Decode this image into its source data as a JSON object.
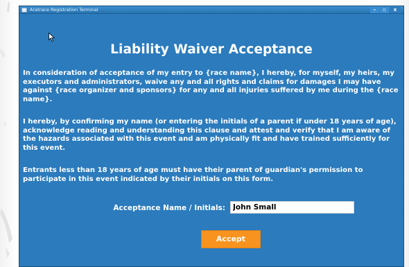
{
  "window": {
    "title": "Aratrace Registration Terminal",
    "controls": {
      "minimize": "–",
      "maximize": "▫",
      "close": "x"
    }
  },
  "heading": "Liability Waiver Acceptance",
  "paragraphs": [
    "In consideration of acceptance of my entry to {race name}, I hereby, for myself, my heirs, my executors and administrators, waive any and all rights and claims for damages I may have against {race organizer and sponsors} for any and all injuries suffered by me during the {race name}.",
    "I hereby, by confirming my name (or entering the initials of a parent if under 18 years of age), acknowledge reading and understanding this clause and attest and verify that I am aware of the hazards associated with this event and am physically fit and have trained sufficiently for this event.",
    "Entrants less than 18 years of age must have their parent of guardian's permission to participate in this event indicated by their initials on this form."
  ],
  "acceptance": {
    "label": "Acceptance Name / Initials:",
    "value": "John Small"
  },
  "accept_button": "Accept",
  "colors": {
    "background": "#2b7bbd",
    "button": "#f7931e",
    "text": "#ffffff"
  }
}
